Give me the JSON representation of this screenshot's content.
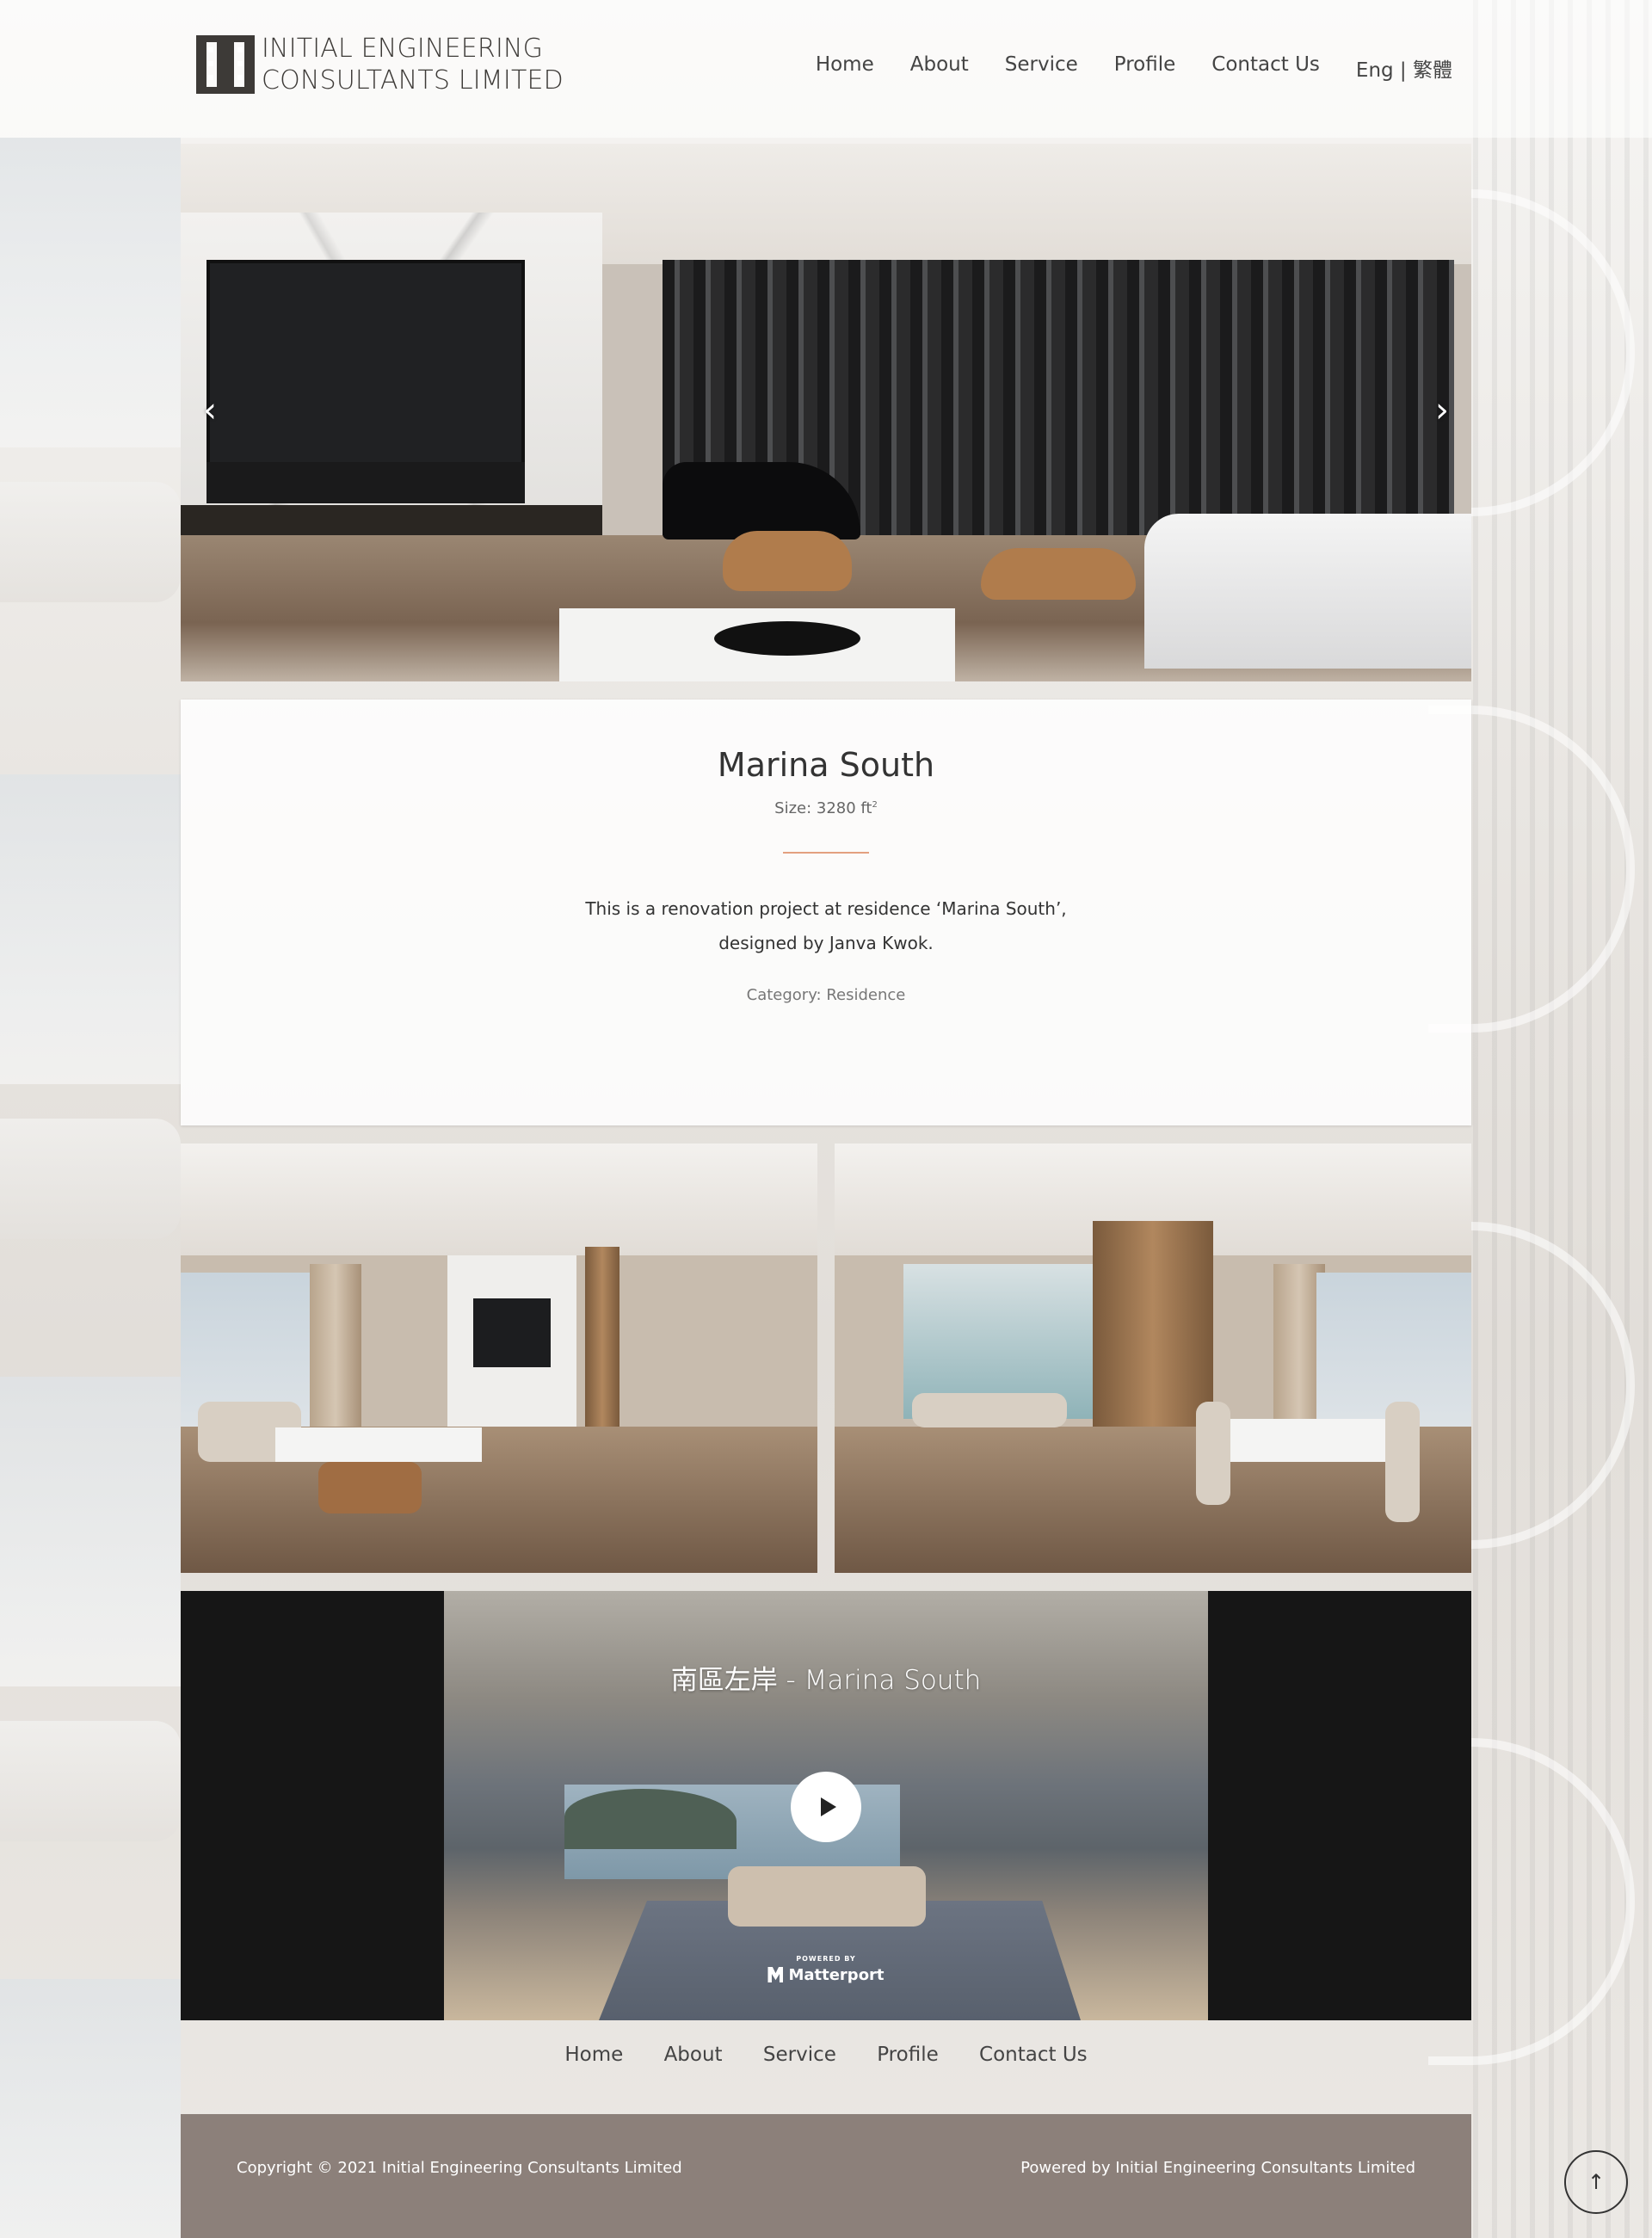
{
  "brand": {
    "line1": "INITIAL ENGINEERING",
    "line2": "CONSULTANTS LIMITED"
  },
  "nav": {
    "items": [
      "Home",
      "About",
      "Service",
      "Profile",
      "Contact Us"
    ],
    "lang": "Eng | 繁體"
  },
  "slider": {
    "prev_icon": "chevron-left",
    "next_icon": "chevron-right",
    "prev_glyph": "‹",
    "next_glyph": "›"
  },
  "project": {
    "title": "Marina South",
    "size_label": "Size: 3280 ft",
    "size_unit_sup": "2",
    "description": "This is a renovation project at residence ‘Marina South’, designed by Janva Kwok.",
    "category": "Category: Residence"
  },
  "tour": {
    "title": "南區左岸 - Marina South",
    "powered_by": "POWERED BY",
    "brand": "Matterport"
  },
  "footer_nav": [
    "Home",
    "About",
    "Service",
    "Profile",
    "Contact Us"
  ],
  "footer": {
    "copyright": "Copyright © 2021 Initial Engineering Consultants Limited",
    "powered": "Powered by Initial Engineering Consultants Limited"
  },
  "back_to_top_glyph": "↑",
  "colors": {
    "accent_divider": "#e3a07f",
    "footer_bg": "#8c807a",
    "text": "#333333"
  }
}
